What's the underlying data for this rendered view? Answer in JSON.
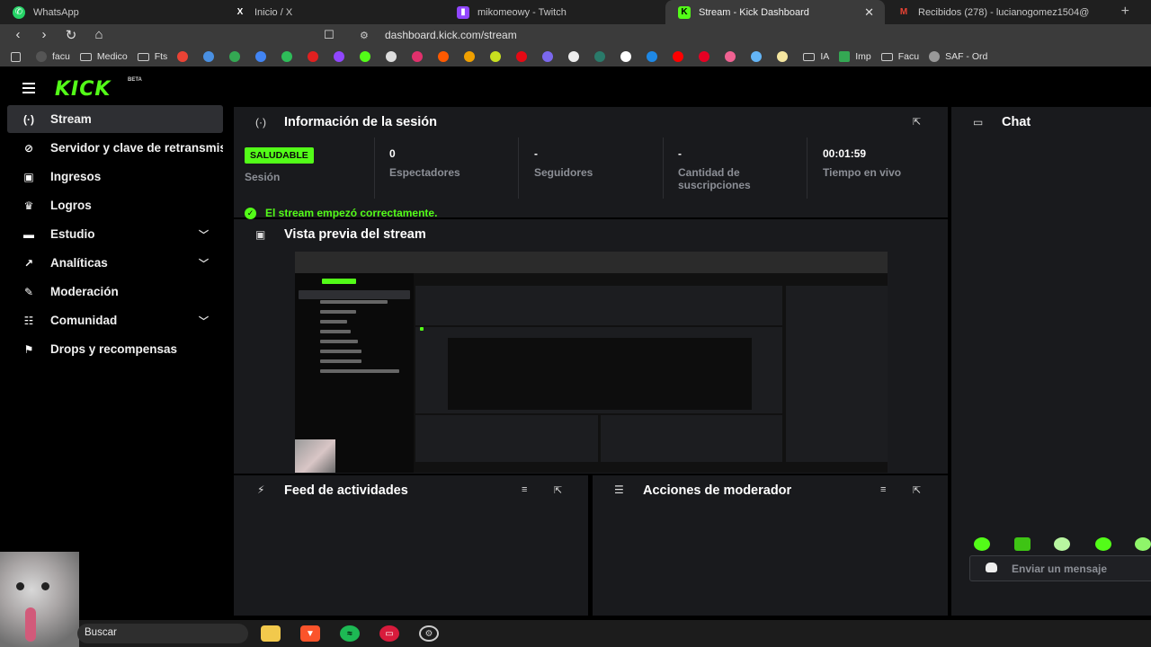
{
  "browser": {
    "tabs": [
      {
        "label": "WhatsApp",
        "icon": "whatsapp-icon",
        "color": "#25d366",
        "active": false
      },
      {
        "label": "Inicio / X",
        "icon": "x-icon",
        "color": "#ffffff",
        "active": false
      },
      {
        "label": "mikomeowy - Twitch",
        "icon": "twitch-icon",
        "color": "#9146ff",
        "active": false
      },
      {
        "label": "Stream - Kick Dashboard",
        "icon": "kick-icon",
        "color": "#53fc18",
        "active": true
      },
      {
        "label": "Recibidos (278) - lucianogomez1504@",
        "icon": "gmail-icon",
        "color": "#ea4335",
        "active": false
      }
    ],
    "close_glyph": "✕",
    "new_tab_glyph": "+",
    "url": "dashboard.kick.com/stream",
    "bookmarks": [
      {
        "label": "facu",
        "type": "site"
      },
      {
        "label": "Medico",
        "type": "folder"
      },
      {
        "label": "Fts",
        "type": "folder"
      },
      {
        "label": "IA",
        "type": "folder"
      },
      {
        "label": "Imp",
        "type": "site"
      },
      {
        "label": "Facu",
        "type": "folder"
      },
      {
        "label": "SAF - Ord",
        "type": "site"
      }
    ]
  },
  "kick": {
    "logo": "KICK",
    "logo_badge": "BETA",
    "sidebar": [
      {
        "label": "Stream",
        "icon": "broadcast-icon",
        "glyph": "(·)",
        "active": true,
        "expandable": false
      },
      {
        "label": "Servidor y clave de retransmisión",
        "icon": "link-icon",
        "glyph": "⊘",
        "active": false,
        "expandable": false
      },
      {
        "label": "Ingresos",
        "icon": "revenue-icon",
        "glyph": "▣",
        "active": false,
        "expandable": false
      },
      {
        "label": "Logros",
        "icon": "trophy-icon",
        "glyph": "♛",
        "active": false,
        "expandable": false
      },
      {
        "label": "Estudio",
        "icon": "studio-icon",
        "glyph": "▬",
        "active": false,
        "expandable": true
      },
      {
        "label": "Analíticas",
        "icon": "analytics-icon",
        "glyph": "↗",
        "active": false,
        "expandable": true
      },
      {
        "label": "Moderación",
        "icon": "wrench-icon",
        "glyph": "✎",
        "active": false,
        "expandable": false
      },
      {
        "label": "Comunidad",
        "icon": "community-icon",
        "glyph": "☷",
        "active": false,
        "expandable": true
      },
      {
        "label": "Drops y recompensas",
        "icon": "drops-icon",
        "glyph": "⚑",
        "active": false,
        "expandable": false
      }
    ],
    "session": {
      "title": "Información de la sesión",
      "status_badge": "SALUDABLE",
      "status_label": "Sesión",
      "stats": [
        {
          "value": "0",
          "label": "Espectadores"
        },
        {
          "value": "-",
          "label": "Seguidores"
        },
        {
          "value": "-",
          "label": "Cantidad de suscripciones"
        },
        {
          "value": "00:01:59",
          "label": "Tiempo en vivo"
        }
      ],
      "ok_message": "El stream empezó correctamente."
    },
    "preview": {
      "title": "Vista previa del stream"
    },
    "feed": {
      "title": "Feed de actividades"
    },
    "mod_actions": {
      "title": "Acciones de moderador"
    },
    "chat": {
      "title": "Chat",
      "placeholder": "Enviar un mensaje"
    }
  },
  "taskbar": {
    "search_label": "Buscar",
    "apps": [
      "file-explorer-icon",
      "brave-icon",
      "spotify-icon",
      "store-icon",
      "steam-icon"
    ]
  },
  "colors": {
    "accent": "#53fc18",
    "panel": "#191a1d",
    "background": "#000000",
    "muted_text": "#8c8f96"
  }
}
